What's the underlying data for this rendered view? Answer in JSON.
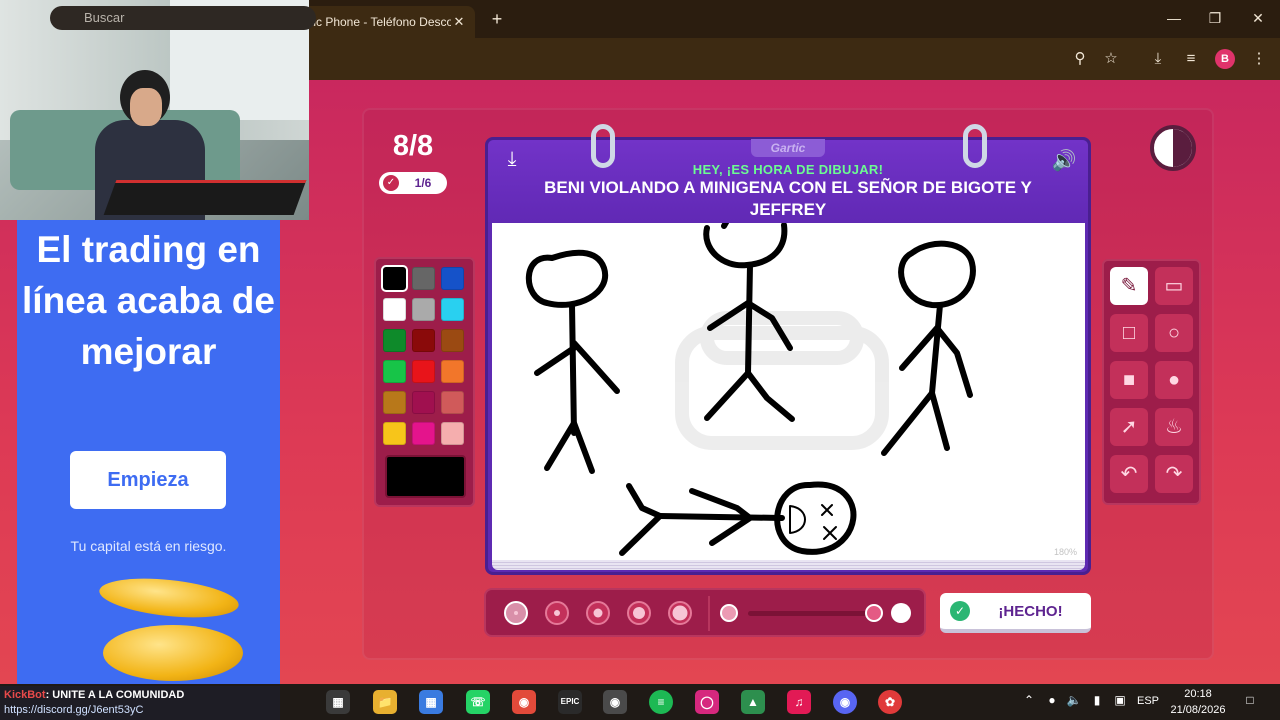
{
  "browser": {
    "tab_title": "tic Phone - Teléfono Descon",
    "tab_close": "✕",
    "new_tab": "+",
    "minimize": "—",
    "restore": "❐",
    "close": "✕",
    "profile_initial": "B"
  },
  "ad": {
    "headline": "El trading en línea acaba de mejorar",
    "cta": "Empieza",
    "note": "Tu capital está en riesgo."
  },
  "game": {
    "round": "8/8",
    "progress": "1/6",
    "brand": "Gartic",
    "prompt_kicker": "HEY, ¡ES HORA DE DIBUJAR!",
    "prompt": "BENI VIOLANDO A MINIGENA CON EL SEÑOR DE BIGOTE Y JEFFREY",
    "zoom": "180%",
    "done_label": "¡HECHO!",
    "palette_colors": [
      "#000000",
      "#666666",
      "#1552c9",
      "#ffffff",
      "#aaaaaa",
      "#29d0f0",
      "#0e8a2a",
      "#8a0a0a",
      "#9b4a12",
      "#17c448",
      "#e8141a",
      "#f2762a",
      "#b8781a",
      "#a0104f",
      "#d05a5a",
      "#f7c51a",
      "#e4148c",
      "#f5aeae"
    ],
    "current_color": "#000000",
    "tools": [
      "pencil-icon",
      "eraser-icon",
      "square-icon",
      "circle-icon",
      "filled-square-icon",
      "filled-circle-icon",
      "line-icon",
      "bucket-icon",
      "undo-icon",
      "redo-icon"
    ]
  },
  "taskbar": {
    "search_placeholder": "Buscar",
    "chat_user": "KickBot",
    "chat_message": ": UNITE A LA COMUNIDAD",
    "chat_link": "https://discord.gg/J6ent53yC",
    "language": "ESP",
    "time": "20:18",
    "date": "21/08/2026"
  }
}
